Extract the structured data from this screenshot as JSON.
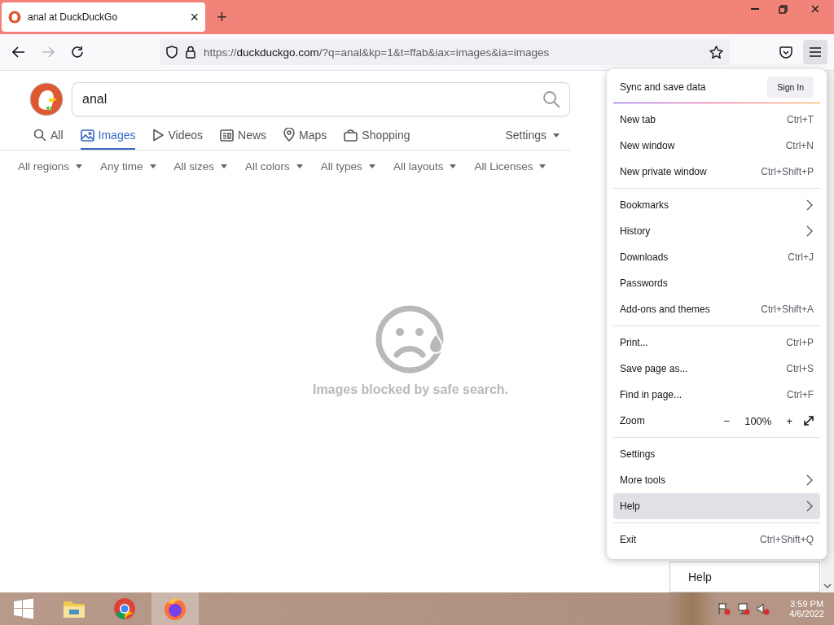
{
  "tab": {
    "title": "anal at DuckDuckGo",
    "close": "×",
    "new_tab": "+"
  },
  "url": {
    "prefix": "https://",
    "host": "duckduckgo.com",
    "path": "/?q=anal&kp=1&t=ffab&iax=images&ia=images"
  },
  "search": {
    "value": "anal"
  },
  "search_tabs": [
    {
      "label": "All",
      "selected": false
    },
    {
      "label": "Images",
      "selected": true
    },
    {
      "label": "Videos",
      "selected": false
    },
    {
      "label": "News",
      "selected": false
    },
    {
      "label": "Maps",
      "selected": false
    },
    {
      "label": "Shopping",
      "selected": false
    }
  ],
  "settings": "Settings",
  "filters": [
    "All regions",
    "Any time",
    "All sizes",
    "All colors",
    "All types",
    "All layouts",
    "All Licenses"
  ],
  "blocked_message": "Images blocked by safe search.",
  "menu": {
    "sync_label": "Sync and save data",
    "sign_in": "Sign In",
    "items": [
      {
        "kind": "item",
        "label": "New tab",
        "shortcut": "Ctrl+T",
        "submenu": false,
        "selected": false
      },
      {
        "kind": "item",
        "label": "New window",
        "shortcut": "Ctrl+N",
        "submenu": false,
        "selected": false
      },
      {
        "kind": "item",
        "label": "New private window",
        "shortcut": "Ctrl+Shift+P",
        "submenu": false,
        "selected": false
      },
      {
        "kind": "separator"
      },
      {
        "kind": "item",
        "label": "Bookmarks",
        "submenu": true,
        "selected": false
      },
      {
        "kind": "item",
        "label": "History",
        "submenu": true,
        "selected": false
      },
      {
        "kind": "item",
        "label": "Downloads",
        "shortcut": "Ctrl+J",
        "submenu": false,
        "selected": false
      },
      {
        "kind": "item",
        "label": "Passwords",
        "submenu": false,
        "selected": false
      },
      {
        "kind": "item",
        "label": "Add-ons and themes",
        "shortcut": "Ctrl+Shift+A",
        "submenu": false,
        "selected": false
      },
      {
        "kind": "separator"
      },
      {
        "kind": "item",
        "label": "Print...",
        "shortcut": "Ctrl+P",
        "submenu": false,
        "selected": false
      },
      {
        "kind": "item",
        "label": "Save page as...",
        "shortcut": "Ctrl+S",
        "submenu": false,
        "selected": false
      },
      {
        "kind": "item",
        "label": "Find in page...",
        "shortcut": "Ctrl+F",
        "submenu": false,
        "selected": false
      },
      {
        "kind": "zoom",
        "label": "Zoom",
        "minus": "−",
        "value": "100%",
        "plus": "+"
      },
      {
        "kind": "separator"
      },
      {
        "kind": "item",
        "label": "Settings",
        "submenu": false,
        "selected": false
      },
      {
        "kind": "item",
        "label": "More tools",
        "submenu": true,
        "selected": false
      },
      {
        "kind": "item",
        "label": "Help",
        "submenu": true,
        "selected": true
      },
      {
        "kind": "separator"
      },
      {
        "kind": "item",
        "label": "Exit",
        "shortcut": "Ctrl+Shift+Q",
        "submenu": false,
        "selected": false
      }
    ]
  },
  "tooltip": "Help",
  "taskbar": {
    "time": "3:59 PM",
    "date": "4/6/2022"
  }
}
